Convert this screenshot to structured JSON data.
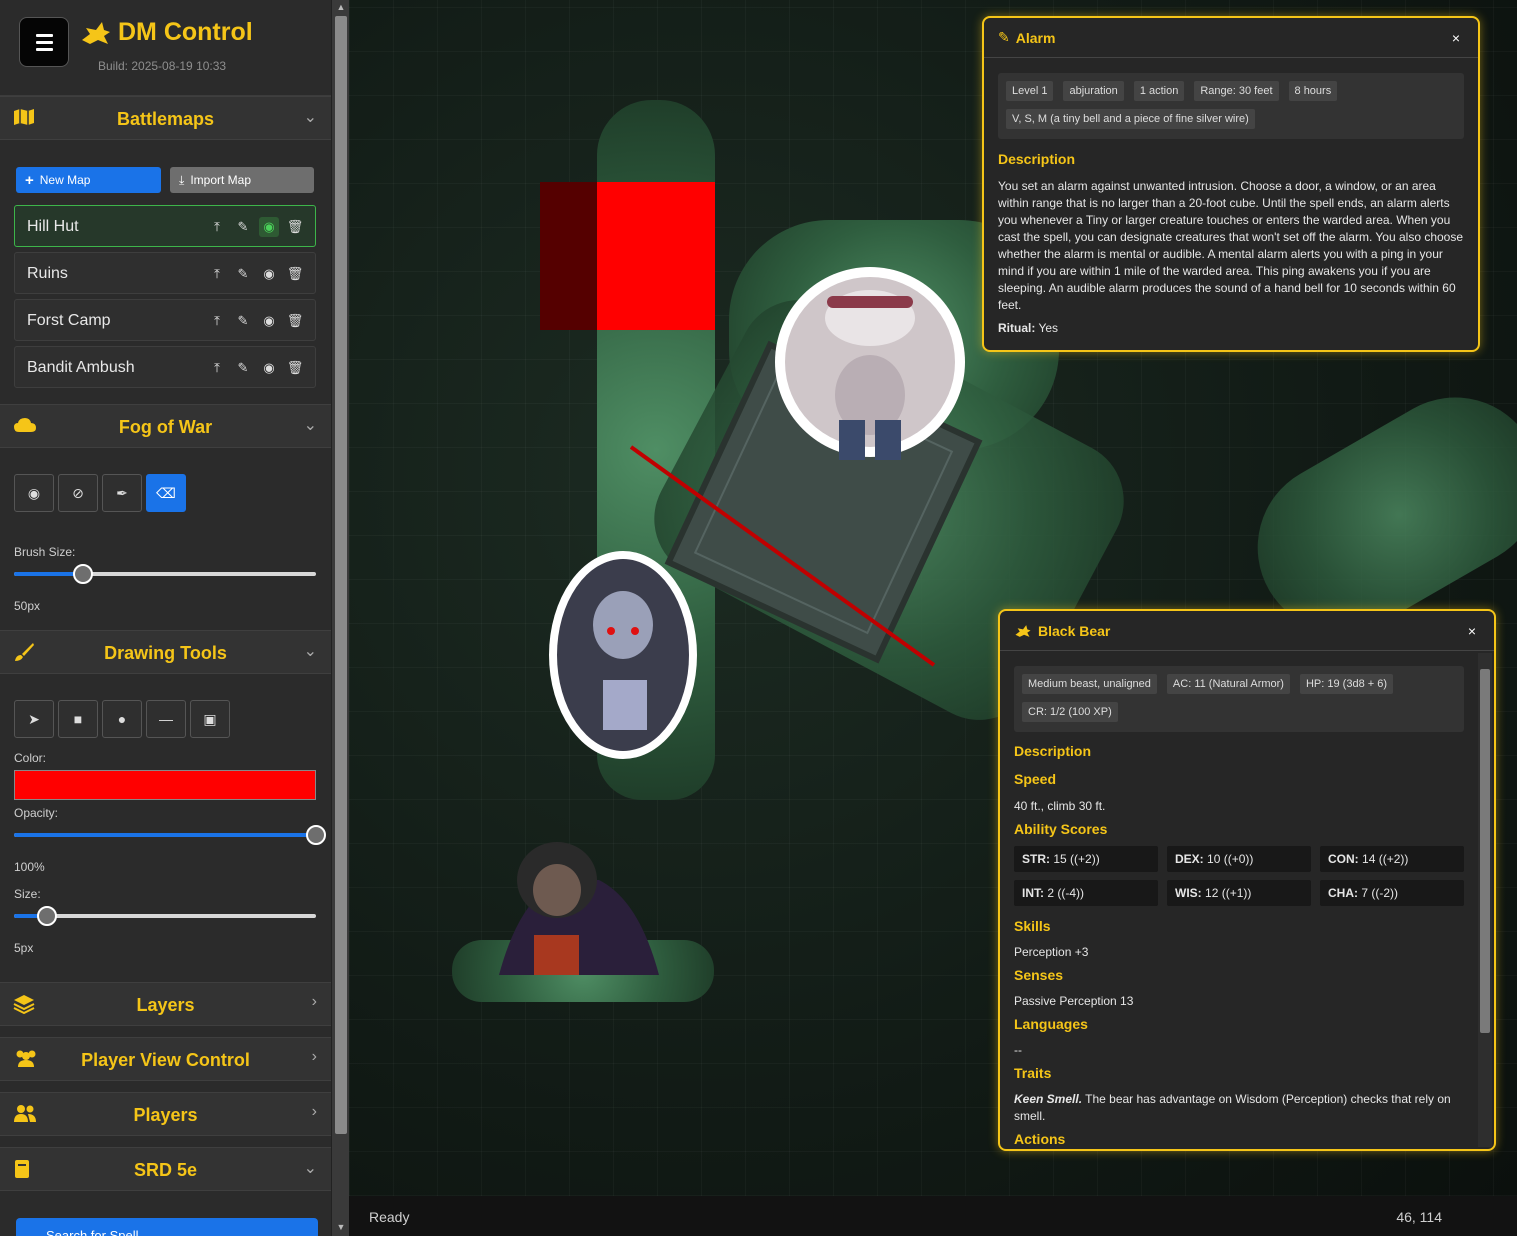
{
  "app": {
    "title": "DM Control",
    "build": "Build: 2025-08-19 10:33"
  },
  "battlemaps": {
    "title": "Battlemaps",
    "new_map": "New Map",
    "import_map": "Import Map",
    "maps": [
      {
        "name": "Hill Hut",
        "active": true
      },
      {
        "name": "Ruins",
        "active": false
      },
      {
        "name": "Forst Camp",
        "active": false
      },
      {
        "name": "Bandit Ambush",
        "active": false
      }
    ]
  },
  "fog": {
    "title": "Fog of War",
    "brush_label": "Brush Size:",
    "brush_value": "50px",
    "brush_fraction": 0.23
  },
  "drawing": {
    "title": "Drawing Tools",
    "color_label": "Color:",
    "color": "#ff0000",
    "opacity_label": "Opacity:",
    "opacity_value": "100%",
    "opacity_fraction": 1.0,
    "size_label": "Size:",
    "size_value": "5px",
    "size_fraction": 0.11
  },
  "sections": {
    "layers": "Layers",
    "player_view": "Player View Control",
    "players": "Players",
    "srd": "SRD 5e"
  },
  "srd": {
    "search_spell": "Search for Spell"
  },
  "status": {
    "text": "Ready",
    "coords": "46, 114"
  },
  "spell_panel": {
    "title": "Alarm",
    "close": "×",
    "tags": [
      "Level 1",
      "abjuration",
      "1 action",
      "Range: 30 feet",
      "8 hours",
      "V, S, M (a tiny bell and a piece of fine silver wire)"
    ],
    "desc_title": "Description",
    "description": "You set an alarm against unwanted intrusion. Choose a door, a window, or an area within range that is no larger than a 20-foot cube. Until the spell ends, an alarm alerts you whenever a Tiny or larger creature touches or enters the warded area. When you cast the spell, you can designate creatures that won't set off the alarm. You also choose whether the alarm is mental or audible. A mental alarm alerts you with a ping in your mind if you are within 1 mile of the warded area. This ping awakens you if you are sleeping. An audible alarm produces the sound of a hand bell for 10 seconds within 60 feet.",
    "ritual_label": "Ritual:",
    "ritual_value": "Yes"
  },
  "monster_panel": {
    "title": "Black Bear",
    "close": "×",
    "tags": [
      "Medium beast, unaligned",
      "AC: 11 (Natural Armor)",
      "HP: 19 (3d8 + 6)",
      "CR: 1/2 (100 XP)"
    ],
    "desc_title": "Description",
    "speed_title": "Speed",
    "speed": "40 ft., climb 30 ft.",
    "ability_title": "Ability Scores",
    "abilities": [
      {
        "label": "STR:",
        "value": "15 ((+2))"
      },
      {
        "label": "DEX:",
        "value": "10 ((+0))"
      },
      {
        "label": "CON:",
        "value": "14 ((+2))"
      },
      {
        "label": "INT:",
        "value": "2 ((-4))"
      },
      {
        "label": "WIS:",
        "value": "12 ((+1))"
      },
      {
        "label": "CHA:",
        "value": "7 ((-2))"
      }
    ],
    "skills_title": "Skills",
    "skills": "Perception +3",
    "senses_title": "Senses",
    "senses": "Passive Perception 13",
    "languages_title": "Languages",
    "languages": "--",
    "traits_title": "Traits",
    "trait_name": "Keen Smell.",
    "trait_text": " The bear has advantage on Wisdom (Perception) checks that rely on smell.",
    "actions_title": "Actions"
  }
}
